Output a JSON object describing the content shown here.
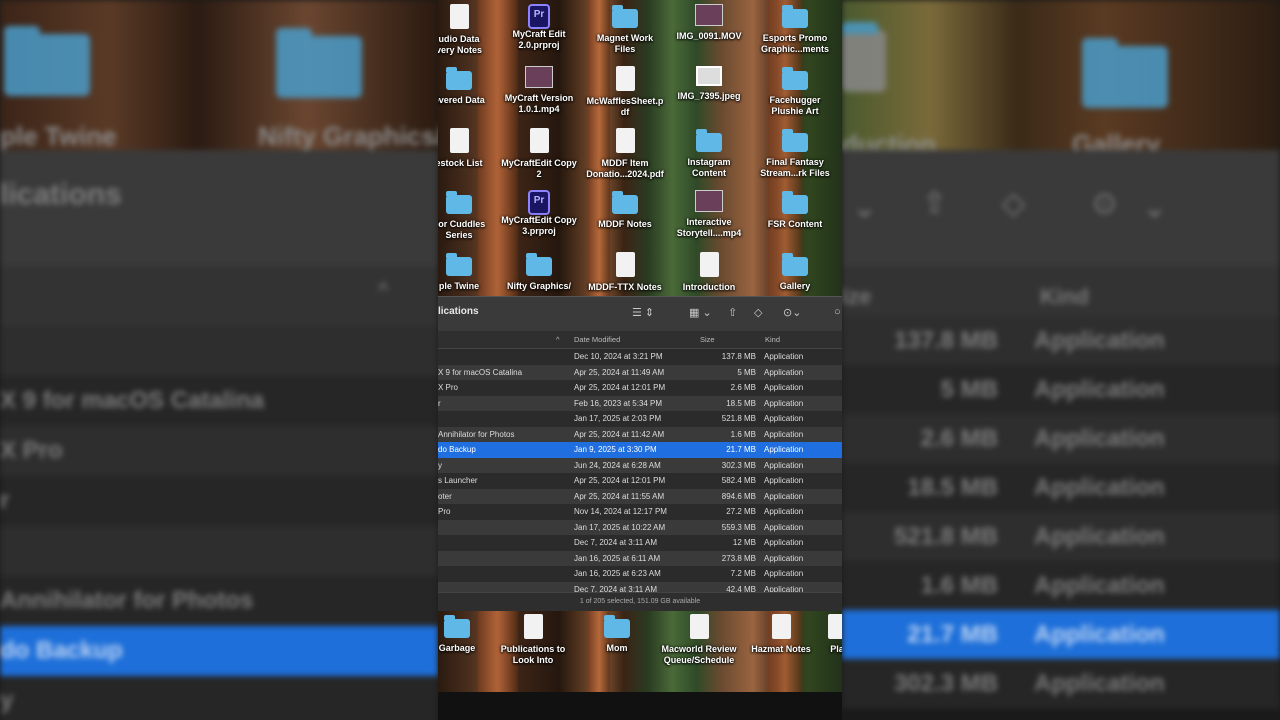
{
  "desktop": {
    "items": [
      {
        "label": "udio Data\nvery Notes",
        "icon": "doc"
      },
      {
        "label": "MyCraft Edit\n2.0.prproj",
        "icon": "pr"
      },
      {
        "label": "Magnet Work\nFiles",
        "icon": "folder"
      },
      {
        "label": "IMG_0091.MOV",
        "icon": "video"
      },
      {
        "label": "Esports Promo\nGraphic...ments",
        "icon": "folder"
      },
      {
        "label": "overed Data",
        "icon": "folder"
      },
      {
        "label": "MyCraft Version\n1.0.1.mp4",
        "icon": "video"
      },
      {
        "label": "McWafflesSheet.p\ndf",
        "icon": "doc"
      },
      {
        "label": "IMG_7395.jpeg",
        "icon": "image"
      },
      {
        "label": "Facehugger\nPlushie Art",
        "icon": "folder"
      },
      {
        "label": "estock List",
        "icon": "doc"
      },
      {
        "label": "MyCraftEdit Copy\n2",
        "icon": "doc"
      },
      {
        "label": "MDDF Item\nDonatio...2024.pdf",
        "icon": "doc"
      },
      {
        "label": "Instagram Content",
        "icon": "folder"
      },
      {
        "label": "Final Fantasy\nStream...rk Files",
        "icon": "folder"
      },
      {
        "label": "For Cuddles\nSeries",
        "icon": "folder"
      },
      {
        "label": "MyCraftEdit Copy\n3.prproj",
        "icon": "pr"
      },
      {
        "label": "MDDF Notes",
        "icon": "folder"
      },
      {
        "label": "Interactive\nStorytell....mp4",
        "icon": "video"
      },
      {
        "label": "FSR Content",
        "icon": "folder"
      },
      {
        "label": "ple Twine",
        "icon": "folder"
      },
      {
        "label": "Nifty Graphics/",
        "icon": "folder"
      },
      {
        "label": "MDDF-TTX Notes",
        "icon": "doc"
      },
      {
        "label": "Introduction",
        "icon": "doc"
      },
      {
        "label": "Gallery",
        "icon": "folder"
      }
    ],
    "bottom_items": [
      {
        "label": "Garbage",
        "icon": "folder"
      },
      {
        "label": "Publications to\nLook Into",
        "icon": "doc"
      },
      {
        "label": "Mom",
        "icon": "folder"
      },
      {
        "label": "Macworld Review\nQueue/Schedule",
        "icon": "doc"
      },
      {
        "label": "Hazmat Notes",
        "icon": "doc"
      },
      {
        "label": "Pla",
        "icon": "doc"
      }
    ]
  },
  "finder": {
    "title": "lications",
    "toolbar_icons": [
      "list-view-icon",
      "grid-view-icon",
      "share-icon",
      "tag-icon",
      "more-icon",
      "search-icon"
    ],
    "columns": {
      "name_sort": "^",
      "date": "Date Modified",
      "size": "Size",
      "kind": "Kind"
    },
    "rows": [
      {
        "name": "",
        "date": "Dec 10, 2024 at 3:21 PM",
        "size": "137.8 MB",
        "kind": "Application"
      },
      {
        "name": "X 9 for macOS Catalina",
        "date": "Apr 25, 2024 at 11:49 AM",
        "size": "5 MB",
        "kind": "Application"
      },
      {
        "name": "X Pro",
        "date": "Apr 25, 2024 at 12:01 PM",
        "size": "2.6 MB",
        "kind": "Application"
      },
      {
        "name": "r",
        "date": "Feb 16, 2023 at 5:34 PM",
        "size": "18.5 MB",
        "kind": "Application"
      },
      {
        "name": "",
        "date": "Jan 17, 2025 at 2:03 PM",
        "size": "521.8 MB",
        "kind": "Application"
      },
      {
        "name": "Annihilator for Photos",
        "date": "Apr 25, 2024 at 11:42 AM",
        "size": "1.6 MB",
        "kind": "Application"
      },
      {
        "name": "do Backup",
        "date": "Jan 9, 2025 at 3:30 PM",
        "size": "21.7 MB",
        "kind": "Application",
        "selected": true
      },
      {
        "name": "y",
        "date": "Jun 24, 2024 at 6:28 AM",
        "size": "302.3 MB",
        "kind": "Application"
      },
      {
        "name": "s Launcher",
        "date": "Apr 25, 2024 at 12:01 PM",
        "size": "582.4 MB",
        "kind": "Application"
      },
      {
        "name": "oter",
        "date": "Apr 25, 2024 at 11:55 AM",
        "size": "894.6 MB",
        "kind": "Application"
      },
      {
        "name": "Pro",
        "date": "Nov 14, 2024 at 12:17 PM",
        "size": "27.2 MB",
        "kind": "Application"
      },
      {
        "name": "",
        "date": "Jan 17, 2025 at 10:22 AM",
        "size": "559.3 MB",
        "kind": "Application"
      },
      {
        "name": "",
        "date": "Dec 7, 2024 at 3:11 AM",
        "size": "12 MB",
        "kind": "Application"
      },
      {
        "name": "",
        "date": "Jan 16, 2025 at 6:11 AM",
        "size": "273.8 MB",
        "kind": "Application"
      },
      {
        "name": "",
        "date": "Jan 16, 2025 at 6:23 AM",
        "size": "7.2 MB",
        "kind": "Application"
      },
      {
        "name": "",
        "date": "Dec 7, 2024 at 3:11 AM",
        "size": "42.4 MB",
        "kind": "Application"
      }
    ],
    "status": "1 of 205 selected, 151.09 GB available"
  },
  "blur_left": {
    "top_labels": [
      "ple Twine",
      "Nifty Graphics/"
    ],
    "title": "lications",
    "rows": [
      "",
      "X 9 for macOS Catalina",
      "X Pro",
      "r",
      "",
      "Annihilator for Photos",
      "do Backup",
      "y"
    ]
  },
  "blur_right": {
    "top_labels": [
      "duction",
      "Gallery"
    ],
    "kind_header": "Kind",
    "size_header": "ize",
    "rows": [
      {
        "size": "137.8 MB",
        "kind": "Application"
      },
      {
        "size": "5 MB",
        "kind": "Application"
      },
      {
        "size": "2.6 MB",
        "kind": "Application"
      },
      {
        "size": "18.5 MB",
        "kind": "Application"
      },
      {
        "size": "521.8 MB",
        "kind": "Application"
      },
      {
        "size": "1.6 MB",
        "kind": "Application"
      },
      {
        "size": "21.7 MB",
        "kind": "Application"
      },
      {
        "size": "302.3 MB",
        "kind": "Application"
      }
    ]
  }
}
